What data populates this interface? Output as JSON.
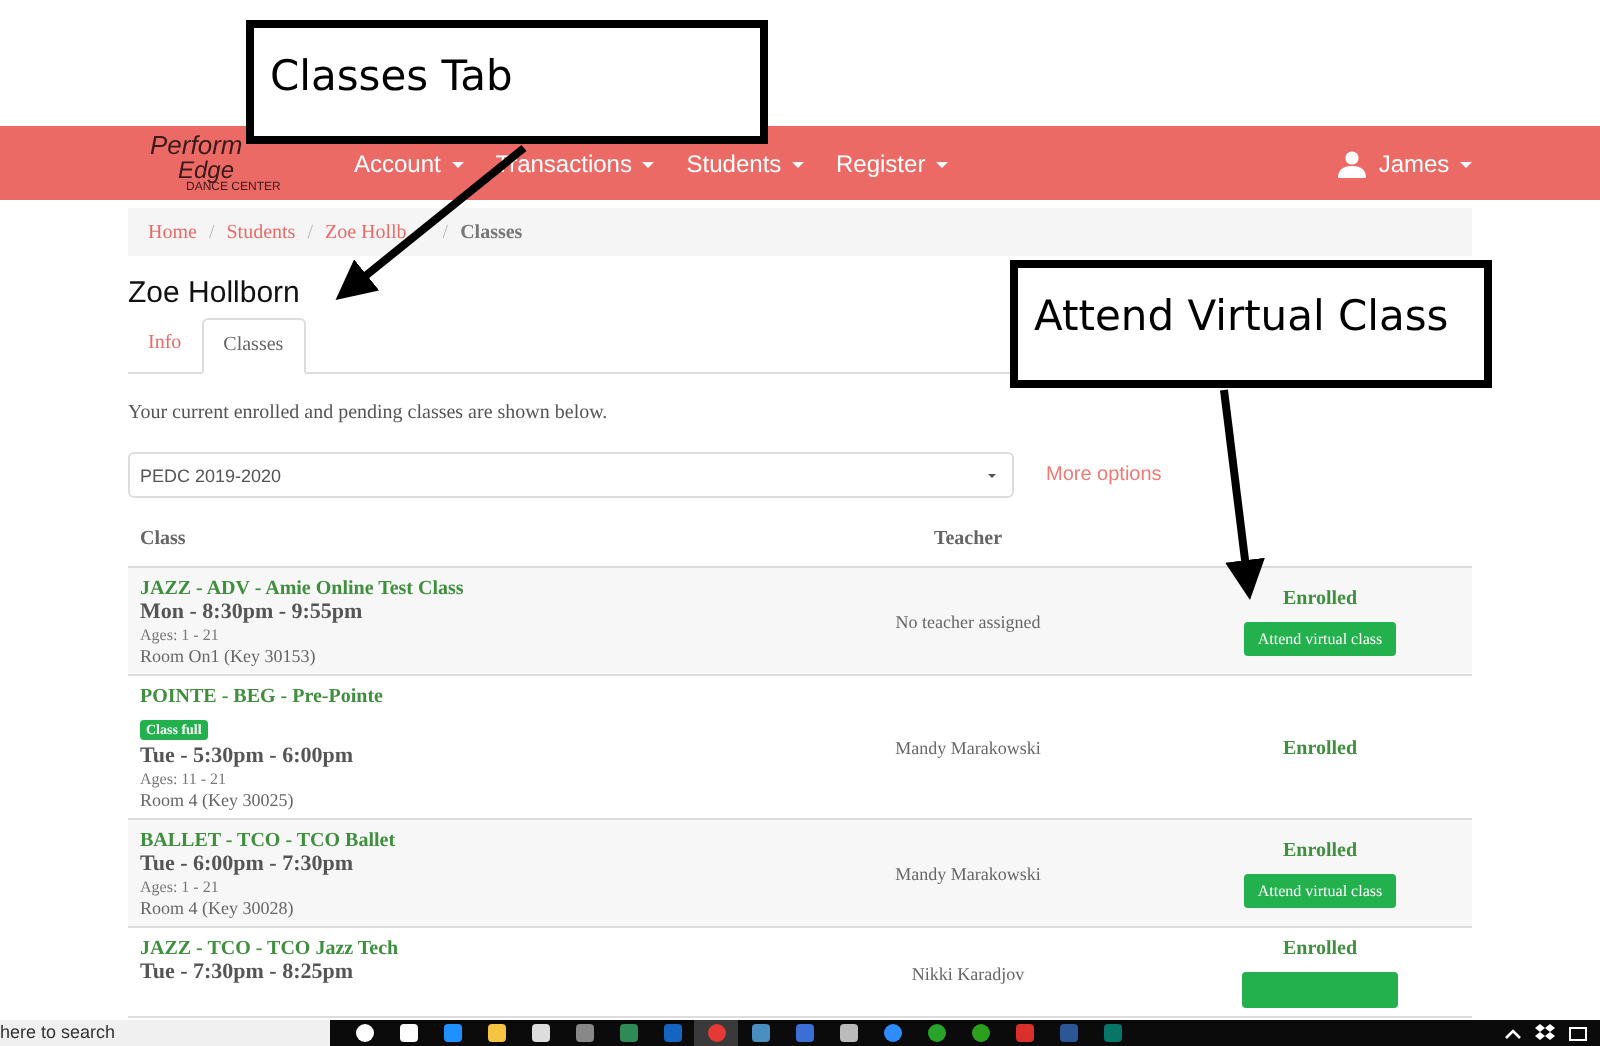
{
  "annotations": [
    {
      "text": "Classes Tab"
    },
    {
      "text": "Attend Virtual Class"
    }
  ],
  "navbar": {
    "logo": [
      "Perform",
      "Edge",
      "DANCE CENTER"
    ],
    "menus": [
      "Account",
      "Transactions",
      "Students",
      "Register"
    ],
    "user": "James"
  },
  "breadcrumb": [
    {
      "label": "Home",
      "current": false
    },
    {
      "sep": "/",
      "label": "Students",
      "current": false
    },
    {
      "sep": "/",
      "label": "Zoe Hollb",
      "current": false
    },
    {
      "sep": "/",
      "label": "Classes",
      "current": true
    }
  ],
  "student_name": "Zoe Hollborn",
  "tabs": [
    {
      "label": "Info",
      "selected": false
    },
    {
      "label": "Classes",
      "selected": true
    }
  ],
  "intro": "Your current enrolled and pending classes are shown below.",
  "season_select": {
    "value": "PEDC 2019-2020"
  },
  "more_options": "More options",
  "table": {
    "columns": [
      "Class",
      "Teacher"
    ],
    "rows": [
      {
        "name": "JAZZ - ADV - Amie Online Test Class",
        "time": "Mon - 8:30pm - 9:55pm",
        "ages": "Ages: 1 - 21",
        "room": "Room On1 (Key 30153)",
        "teacher": "No teacher assigned",
        "status": "Enrolled",
        "action": "Attend virtual class"
      },
      {
        "name": "POINTE - BEG - Pre-Pointe",
        "badge": "Class full",
        "time": "Tue - 5:30pm - 6:00pm",
        "ages": "Ages: 11 - 21",
        "room": "Room 4 (Key 30025)",
        "teacher": "Mandy Marakowski",
        "status": "Enrolled"
      },
      {
        "name": "BALLET - TCO - TCO Ballet",
        "time": "Tue - 6:00pm - 7:30pm",
        "ages": "Ages: 1 - 21",
        "room": "Room 4 (Key 30028)",
        "teacher": "Mandy Marakowski",
        "status": "Enrolled",
        "action": "Attend virtual class"
      },
      {
        "name": "JAZZ - TCO - TCO Jazz Tech",
        "time": "Tue - 7:30pm - 8:25pm",
        "teacher": "Nikki Karadjov",
        "status": "Enrolled",
        "action_cut": true
      }
    ]
  },
  "taskbar": {
    "search": "here to search"
  }
}
